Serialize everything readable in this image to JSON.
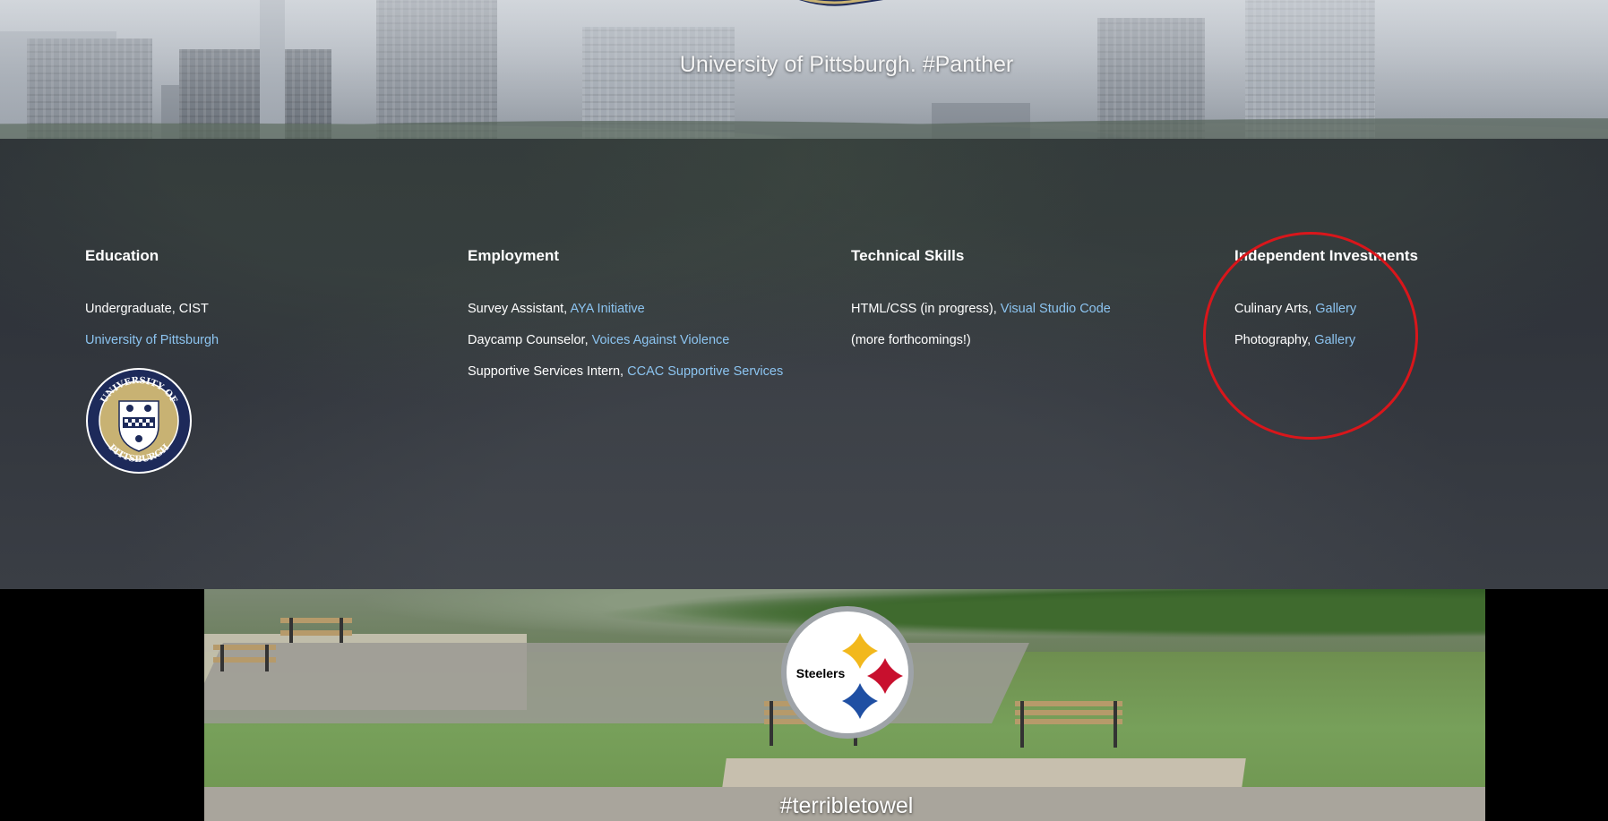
{
  "hero": {
    "title": "University of Pittsburgh. #Panther"
  },
  "columns": {
    "education": {
      "heading": "Education",
      "line1": "Undergraduate, CIST",
      "link1": "University of Pittsburgh",
      "seal": {
        "top_text": "UNIVERSITY OF",
        "bottom_text": "PITTSBURGH",
        "colors": {
          "navy": "#1d2a5a",
          "gold": "#c8b273"
        }
      }
    },
    "employment": {
      "heading": "Employment",
      "items": [
        {
          "role": "Survey Assistant, ",
          "org": "AYA Initiative"
        },
        {
          "role": "Daycamp Counselor, ",
          "org": "Voices Against Violence"
        },
        {
          "role": "Supportive Services Intern, ",
          "org": "CCAC Supportive Services"
        }
      ]
    },
    "technical": {
      "heading": "Technical Skills",
      "items": [
        {
          "text": "HTML/CSS (in progress), ",
          "link": "Visual Studio Code"
        },
        {
          "text": "(more forthcomings!)",
          "link": ""
        }
      ]
    },
    "investments": {
      "heading": "Independent Investments",
      "items": [
        {
          "text": "Culinary Arts, ",
          "link": "Gallery"
        },
        {
          "text": "Photography, ",
          "link": "Gallery"
        }
      ]
    }
  },
  "steelers_logo": {
    "text": "Steelers",
    "colors": {
      "yellow": "#f2b81c",
      "red": "#c8102e",
      "blue": "#1f4fa3"
    }
  },
  "tagline": "#terribletowel",
  "colors": {
    "link": "#8cc4f0",
    "annotation_circle": "#d9161b",
    "section_bg": "#30343b"
  }
}
